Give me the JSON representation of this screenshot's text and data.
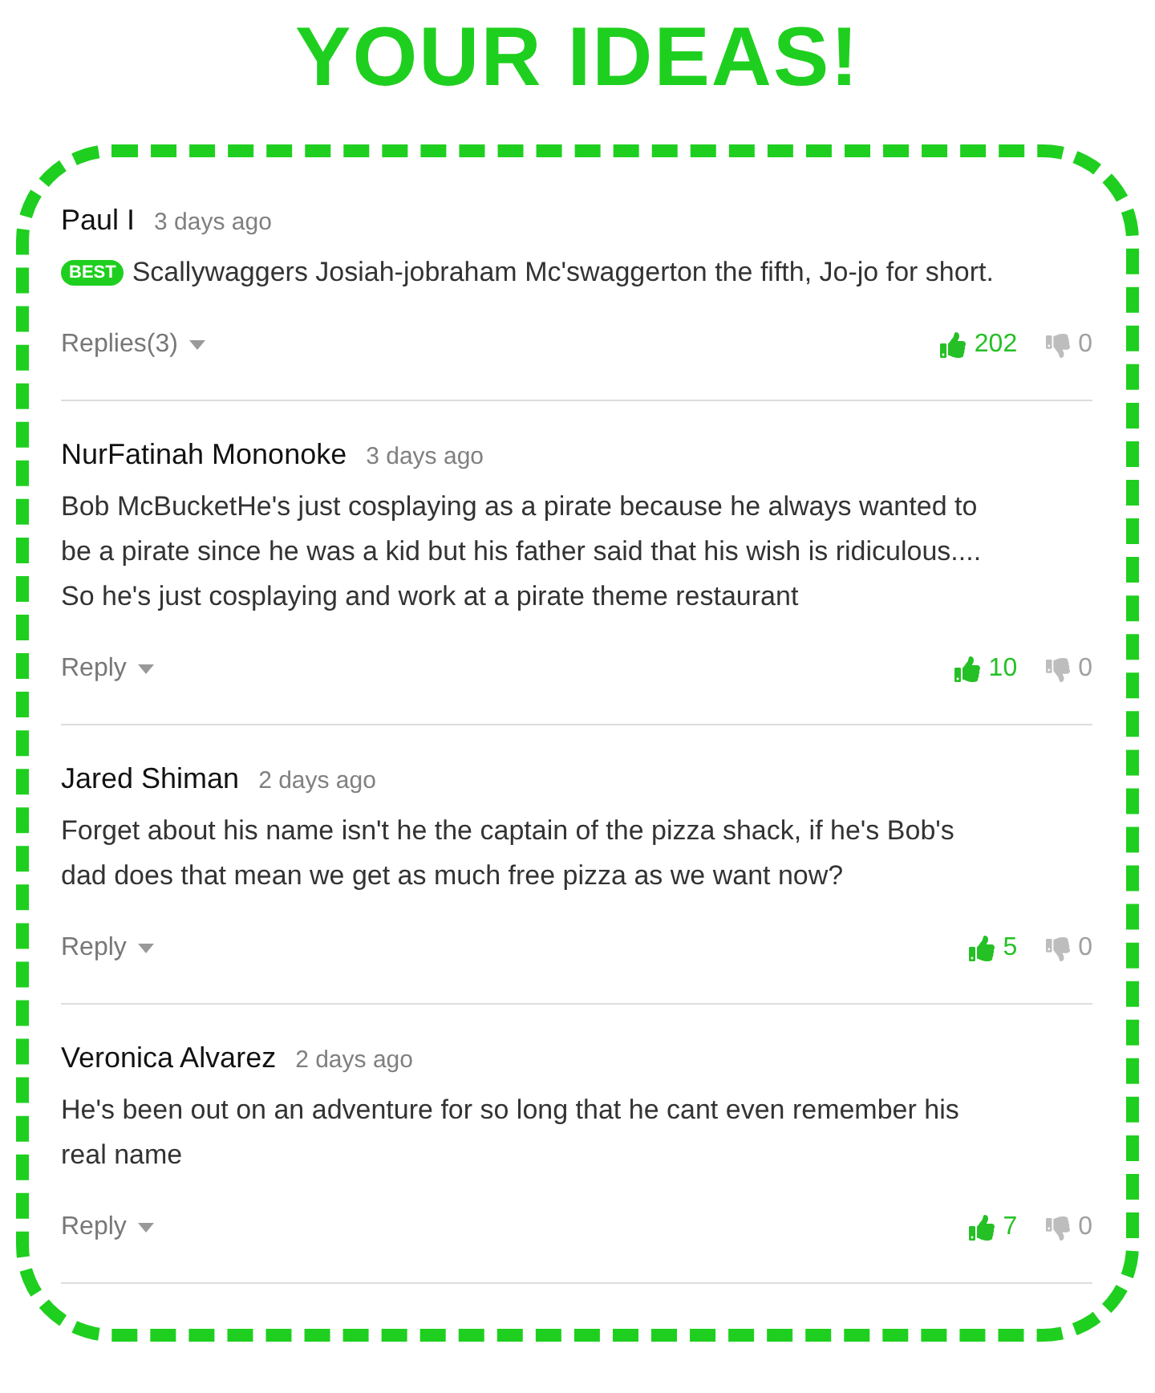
{
  "title": "YOUR IDEAS!",
  "comments": [
    {
      "author": "Paul I",
      "time": "3 days ago",
      "badge": "BEST",
      "body_lines": [
        "Scallywaggers Josiah-jobraham Mc'swaggerton the fifth, Jo-jo for short."
      ],
      "reply_label": "Replies(3)",
      "likes": "202",
      "dislikes": "0"
    },
    {
      "author": "NurFatinah Mononoke",
      "time": "3 days ago",
      "body_lines": [
        "Bob McBucketHe's just cosplaying as a pirate because he always wanted to",
        "be a pirate since he was a kid but his father said that his wish is ridiculous....",
        "So he's just cosplaying and work at a pirate theme restaurant"
      ],
      "reply_label": "Reply",
      "likes": "10",
      "dislikes": "0"
    },
    {
      "author": "Jared Shiman",
      "time": "2 days ago",
      "body_lines": [
        "Forget about his name isn't he the captain of the pizza shack, if he's Bob's",
        "dad does that mean we get as much free pizza as we want now?"
      ],
      "reply_label": "Reply",
      "likes": "5",
      "dislikes": "0"
    },
    {
      "author": "Veronica Alvarez",
      "time": "2 days ago",
      "body_lines": [
        "He's been out on an adventure for so long that he cant even remember his",
        "real name"
      ],
      "reply_label": "Reply",
      "likes": "7",
      "dislikes": "0"
    }
  ]
}
